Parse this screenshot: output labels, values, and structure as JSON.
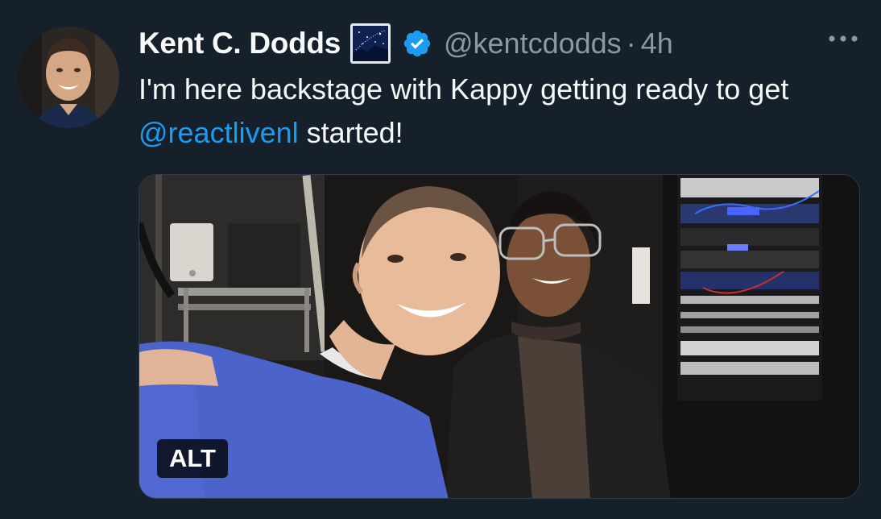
{
  "author": {
    "display_name": "Kent C. Dodds",
    "handle": "@kentcdodds",
    "separator": "·",
    "time": "4h",
    "avatar_icon": "avatar-photo",
    "badge_icon": "starry-sky-emoji-icon",
    "verified_icon": "verified-badge-icon",
    "verified_color": "#1d9bf0"
  },
  "tweet": {
    "text_part1": "I'm here backstage with Kappy getting ready to get ",
    "mention": "@reactlivenl",
    "text_part2": " started!",
    "mention_color": "#1d9bf0"
  },
  "media": {
    "alt_label": "ALT",
    "description_icon": "selfie-photo"
  },
  "actions": {
    "more_icon": "more-options-icon"
  },
  "colors": {
    "background": "#15202b",
    "primary_text": "#f7f9f9",
    "secondary_text": "#8b98a5",
    "accent": "#1d9bf0"
  }
}
